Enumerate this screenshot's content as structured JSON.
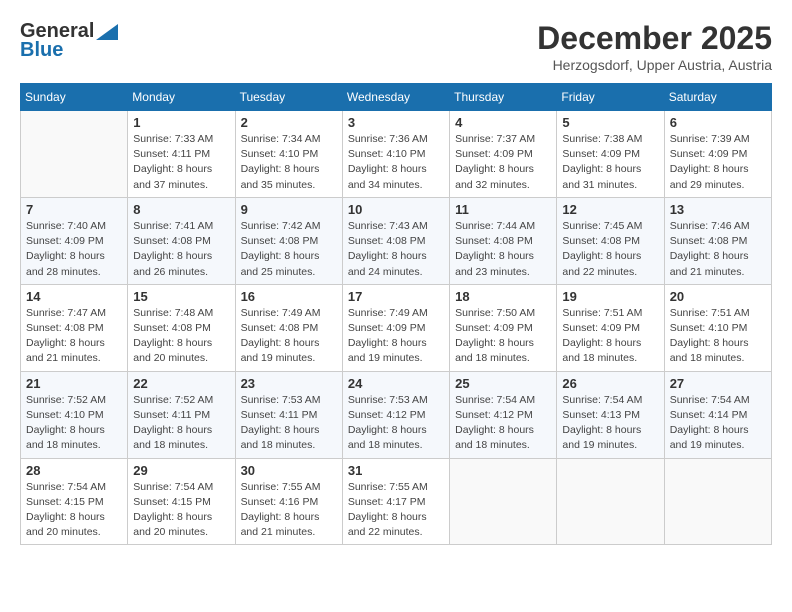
{
  "header": {
    "logo_general": "General",
    "logo_blue": "Blue",
    "month": "December 2025",
    "location": "Herzogsdorf, Upper Austria, Austria"
  },
  "days_of_week": [
    "Sunday",
    "Monday",
    "Tuesday",
    "Wednesday",
    "Thursday",
    "Friday",
    "Saturday"
  ],
  "weeks": [
    [
      {
        "day": "",
        "info": ""
      },
      {
        "day": "1",
        "info": "Sunrise: 7:33 AM\nSunset: 4:11 PM\nDaylight: 8 hours\nand 37 minutes."
      },
      {
        "day": "2",
        "info": "Sunrise: 7:34 AM\nSunset: 4:10 PM\nDaylight: 8 hours\nand 35 minutes."
      },
      {
        "day": "3",
        "info": "Sunrise: 7:36 AM\nSunset: 4:10 PM\nDaylight: 8 hours\nand 34 minutes."
      },
      {
        "day": "4",
        "info": "Sunrise: 7:37 AM\nSunset: 4:09 PM\nDaylight: 8 hours\nand 32 minutes."
      },
      {
        "day": "5",
        "info": "Sunrise: 7:38 AM\nSunset: 4:09 PM\nDaylight: 8 hours\nand 31 minutes."
      },
      {
        "day": "6",
        "info": "Sunrise: 7:39 AM\nSunset: 4:09 PM\nDaylight: 8 hours\nand 29 minutes."
      }
    ],
    [
      {
        "day": "7",
        "info": "Sunrise: 7:40 AM\nSunset: 4:09 PM\nDaylight: 8 hours\nand 28 minutes."
      },
      {
        "day": "8",
        "info": "Sunrise: 7:41 AM\nSunset: 4:08 PM\nDaylight: 8 hours\nand 26 minutes."
      },
      {
        "day": "9",
        "info": "Sunrise: 7:42 AM\nSunset: 4:08 PM\nDaylight: 8 hours\nand 25 minutes."
      },
      {
        "day": "10",
        "info": "Sunrise: 7:43 AM\nSunset: 4:08 PM\nDaylight: 8 hours\nand 24 minutes."
      },
      {
        "day": "11",
        "info": "Sunrise: 7:44 AM\nSunset: 4:08 PM\nDaylight: 8 hours\nand 23 minutes."
      },
      {
        "day": "12",
        "info": "Sunrise: 7:45 AM\nSunset: 4:08 PM\nDaylight: 8 hours\nand 22 minutes."
      },
      {
        "day": "13",
        "info": "Sunrise: 7:46 AM\nSunset: 4:08 PM\nDaylight: 8 hours\nand 21 minutes."
      }
    ],
    [
      {
        "day": "14",
        "info": "Sunrise: 7:47 AM\nSunset: 4:08 PM\nDaylight: 8 hours\nand 21 minutes."
      },
      {
        "day": "15",
        "info": "Sunrise: 7:48 AM\nSunset: 4:08 PM\nDaylight: 8 hours\nand 20 minutes."
      },
      {
        "day": "16",
        "info": "Sunrise: 7:49 AM\nSunset: 4:08 PM\nDaylight: 8 hours\nand 19 minutes."
      },
      {
        "day": "17",
        "info": "Sunrise: 7:49 AM\nSunset: 4:09 PM\nDaylight: 8 hours\nand 19 minutes."
      },
      {
        "day": "18",
        "info": "Sunrise: 7:50 AM\nSunset: 4:09 PM\nDaylight: 8 hours\nand 18 minutes."
      },
      {
        "day": "19",
        "info": "Sunrise: 7:51 AM\nSunset: 4:09 PM\nDaylight: 8 hours\nand 18 minutes."
      },
      {
        "day": "20",
        "info": "Sunrise: 7:51 AM\nSunset: 4:10 PM\nDaylight: 8 hours\nand 18 minutes."
      }
    ],
    [
      {
        "day": "21",
        "info": "Sunrise: 7:52 AM\nSunset: 4:10 PM\nDaylight: 8 hours\nand 18 minutes."
      },
      {
        "day": "22",
        "info": "Sunrise: 7:52 AM\nSunset: 4:11 PM\nDaylight: 8 hours\nand 18 minutes."
      },
      {
        "day": "23",
        "info": "Sunrise: 7:53 AM\nSunset: 4:11 PM\nDaylight: 8 hours\nand 18 minutes."
      },
      {
        "day": "24",
        "info": "Sunrise: 7:53 AM\nSunset: 4:12 PM\nDaylight: 8 hours\nand 18 minutes."
      },
      {
        "day": "25",
        "info": "Sunrise: 7:54 AM\nSunset: 4:12 PM\nDaylight: 8 hours\nand 18 minutes."
      },
      {
        "day": "26",
        "info": "Sunrise: 7:54 AM\nSunset: 4:13 PM\nDaylight: 8 hours\nand 19 minutes."
      },
      {
        "day": "27",
        "info": "Sunrise: 7:54 AM\nSunset: 4:14 PM\nDaylight: 8 hours\nand 19 minutes."
      }
    ],
    [
      {
        "day": "28",
        "info": "Sunrise: 7:54 AM\nSunset: 4:15 PM\nDaylight: 8 hours\nand 20 minutes."
      },
      {
        "day": "29",
        "info": "Sunrise: 7:54 AM\nSunset: 4:15 PM\nDaylight: 8 hours\nand 20 minutes."
      },
      {
        "day": "30",
        "info": "Sunrise: 7:55 AM\nSunset: 4:16 PM\nDaylight: 8 hours\nand 21 minutes."
      },
      {
        "day": "31",
        "info": "Sunrise: 7:55 AM\nSunset: 4:17 PM\nDaylight: 8 hours\nand 22 minutes."
      },
      {
        "day": "",
        "info": ""
      },
      {
        "day": "",
        "info": ""
      },
      {
        "day": "",
        "info": ""
      }
    ]
  ]
}
